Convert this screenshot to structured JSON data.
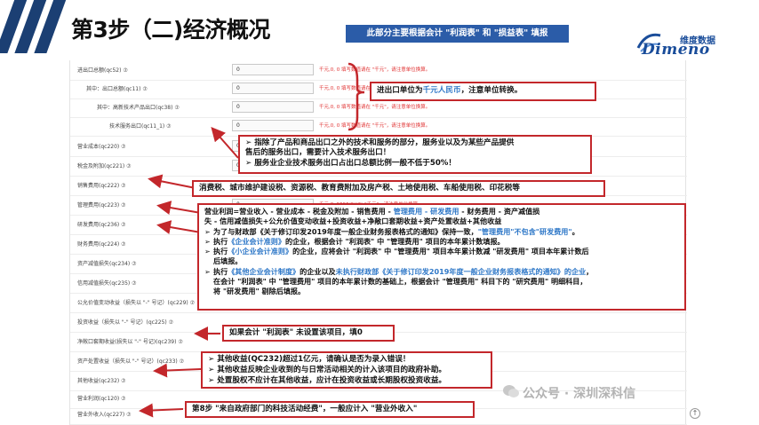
{
  "header": {
    "title": "第3步（二)经济概况",
    "banner": "此部分主要根据会计 \"利润表\" 和 \"损益表\" 填报",
    "logo_cn": "维度数据",
    "logo_en": "Dimeno"
  },
  "form_rows": [
    {
      "label": "进出口总额(qc52) ⑦",
      "value": "0",
      "msg": "千元,0, 0 填写数值请在 \"千元\"，请注意单位换算。"
    },
    {
      "label": "其中：出口总额(qc11) ⑦",
      "value": "0",
      "msg": "千元,0, 0 填写数值请在 \"千元\"，请注意单位换算。"
    },
    {
      "label": "其中：高新技术产品出口(qc38) ⑦",
      "value": "0",
      "msg": "千元,0, 0 填写数值请在 \"千元\"，请注意单位换算。"
    },
    {
      "label": "技术服务出口(qc11_1) ⑦",
      "value": "0",
      "msg": "千元,0, 0 填写数值请在 \"千元\"，请注意单位换算。"
    },
    {
      "label": "营业成本(qc220) ⑦",
      "value": "0",
      "msg": ""
    },
    {
      "label": "税金及附加(qc221) ⑦",
      "value": "0",
      "msg": ""
    },
    {
      "label": "销售费用(qc222) ⑦",
      "value": "",
      "msg": ""
    },
    {
      "label": "管理费用(qc223) ⑦",
      "value": "0",
      "msg": "千元,0, 5555(5)(3) \"千元\"，请注意单位换算。"
    },
    {
      "label": "研发费用(qc236) ⑦",
      "value": "",
      "msg": ""
    },
    {
      "label": "财务费用(qc224) ⑦",
      "value": "",
      "msg": ""
    },
    {
      "label": "资产减值损失(qc234) ⑦",
      "value": "",
      "msg": ""
    },
    {
      "label": "信用减值损失(qc235) ⑦",
      "value": "",
      "msg": ""
    },
    {
      "label": "公允价值变动收益（损失以 \"-\" 号记）(qc229) ⑦",
      "value": "",
      "msg": ""
    },
    {
      "label": "投资收益（损失以 \"-\" 号记）(qc225) ⑦",
      "value": "",
      "msg": ""
    },
    {
      "label": "净敞口套期收益(损失以 \"-\" 号记)(qc239) ⑦",
      "value": "",
      "msg": ""
    },
    {
      "label": "资产处置收益（损失以 \"-\" 号记）(qc233) ⑦",
      "value": "",
      "msg": ""
    },
    {
      "label": "其他收益(qc232) ⑦",
      "value": "",
      "msg": ""
    },
    {
      "label": "营业利润(qc120) ⑦",
      "value": "",
      "msg": ""
    },
    {
      "label": "营业外收入(qc227) ⑦",
      "value": "",
      "msg": ""
    }
  ],
  "callouts": {
    "export_unit": {
      "prefix": "进出口单位为",
      "unit": "千元人民币",
      "suffix": "，注意单位转换。"
    },
    "service_export": {
      "lines": [
        "➢ 指除了产品和商品出口之外的技术和服务的部分，服务业以及为某些产品提供",
        "    售后的服务出口，需要计入技术服务出口！",
        "➢ 服务业企业技术服务出口占出口总额比例一般不低于50%！"
      ]
    },
    "taxes": "消费税、城市维护建设税、资源税、教育费附加及房产税、土地使用税、车船使用税、印花税等",
    "profit": {
      "line1_a": "营业利润=营业收入 - 营业成本 - 税金及附加 - 销售费用 - ",
      "line1_b": "管理费用 - 研发费用",
      "line1_c": " - 财务费用 - 资产减值损",
      "line2": "失 - 信用减值损失+公允价值变动收益+投资收益+净敞口套期收益+资产处置收益+其他收益",
      "b1_a": "为了与财政部《关于修订印发2019年度一般企业财务报表格式的通知》保持一致，",
      "b1_b": "\"管理费用\"不包含\"研发费用\"",
      "b1_c": "。",
      "b2_a": "执行",
      "b2_b": "《企业会计准则》",
      "b2_c": "的企业，根据会计 \"利润表\" 中 \"管理费用\" 项目的本年累计数填报。",
      "b3_a": "执行",
      "b3_b": "《小企业会计准则》",
      "b3_c": "的企业，应将会计 \"利润表\" 中 \"管理费用\" 项目本年累计数减 \"研发费用\" 项目本年累计数后",
      "b3_d": "后填报。",
      "b4_a": "执行",
      "b4_b": "《其他企业会计制度》",
      "b4_c": "的企业以及",
      "b4_d": "未执行财政部《关于修订印发2019年度一般企业财务报表格式的通知》的企业",
      "b4_e": "，",
      "b4_f": "在会计 \"利润表\" 中 \"管理费用\" 项目的本年累计数的基础上，根据会计 \"管理费用\" 科目下的 \"研究费用\" 明细科目，",
      "b4_g": "将 \"研发费用\" 剔除后填报。"
    },
    "net_hedge": "如果会计 \"利润表\" 未设置该项目，填0",
    "other_income": [
      "➢ 其他收益(QC232)超过1亿元，请确认是否为录入错误！",
      "➢ 其他收益反映企业收到的与日常活动相关的计入该项目的政府补助。",
      "➢ 处置股权不应计在其他收益，应计在投资收益或长期股权投资收益。"
    ],
    "nonop_income": "第8步 \"来自政府部门的科技活动经费\"，一般应计入 \"营业外收入\""
  },
  "watermark": "公众号 · 深圳深科信",
  "colors": {
    "callout_border": "#c3272b",
    "banner": "#2b5ca8",
    "highlight_blue": "#2f78c8",
    "highlight_red": "#c3272b",
    "header_stripe": "#1b3f73"
  }
}
